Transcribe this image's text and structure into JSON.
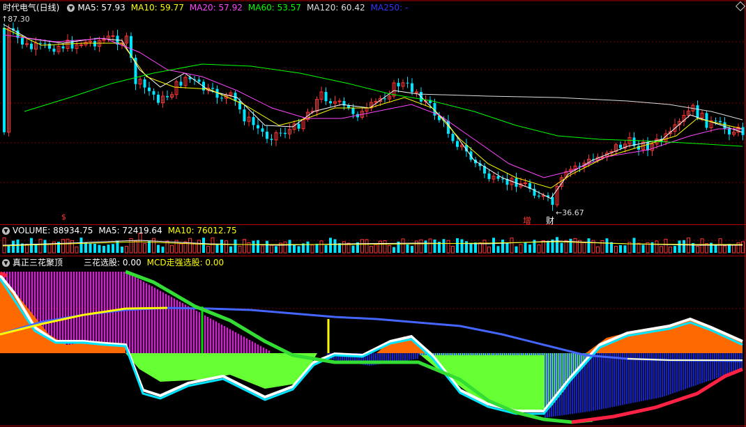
{
  "panel_main": {
    "title": "时代电气(日线)",
    "toggle_icon": "chevron-down-icon",
    "ma5": "MA5: 57.93",
    "ma10": "MA10: 59.77",
    "ma20": "MA20: 57.92",
    "ma60": "MA60: 53.57",
    "ma120": "MA120: 60.42",
    "ma250": "MA250: -",
    "high_label": "87.30",
    "low_label": "36.67",
    "marker_increase": "增",
    "marker_finance": "财",
    "marker_s": "$",
    "colors": {
      "ma5": "#ffffff",
      "ma10": "#ffff00",
      "ma20": "#ff44ff",
      "ma60": "#00ff00",
      "ma120": "#dddddd",
      "ma250": "#3333ff",
      "up": "#ff3333",
      "down": "#00e5ff"
    }
  },
  "panel_volume": {
    "vol": "VOLUME: 88934.75",
    "ma5": "MA5: 72419.64",
    "ma10": "MA10: 76012.75"
  },
  "panel_indicator": {
    "name": "真正三花聚顶",
    "sanhua": "三花选股: 0.00",
    "mcd": "MCD走强选股: 0.00"
  }
}
